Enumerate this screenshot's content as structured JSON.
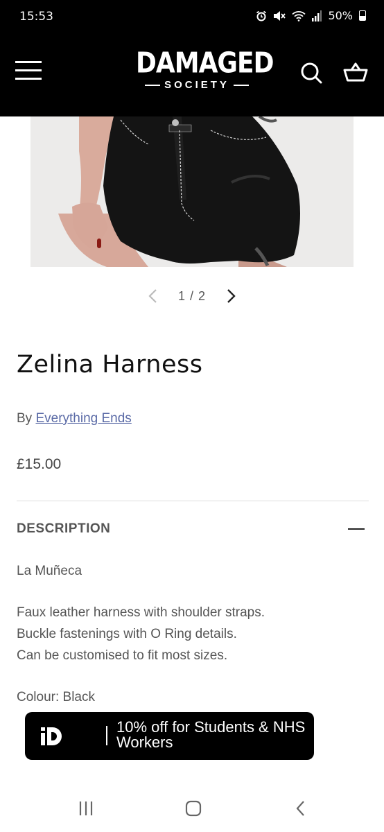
{
  "status_bar": {
    "time": "15:53",
    "battery": "50%"
  },
  "header": {
    "logo_top": "DAMAGED",
    "logo_bottom": "SOCIETY"
  },
  "gallery": {
    "counter": "1 / 2"
  },
  "product": {
    "title": "Zelina Harness",
    "vendor_prefix": "By ",
    "vendor": "Everything Ends",
    "price": "£15.00"
  },
  "description": {
    "heading": "DESCRIPTION",
    "brand": "La Muñeca",
    "lines": [
      "Faux leather harness with shoulder straps.",
      "Buckle fastenings with O Ring details.",
      "Can be customised to fit most sizes."
    ],
    "colour": "Colour: Black"
  },
  "promo": {
    "text": "10% off for Students & NHS Workers"
  },
  "colors": {
    "header_bg": "#000000",
    "link": "#5a6aa6",
    "text_muted": "#555555"
  },
  "icons": [
    "alarm-icon",
    "mute-icon",
    "wifi-icon",
    "signal-icon",
    "battery-icon",
    "menu-icon",
    "search-icon",
    "basket-icon",
    "chevron-left-icon",
    "chevron-right-icon",
    "minus-icon",
    "idays-logo-icon",
    "recents-icon",
    "home-icon",
    "back-icon"
  ]
}
